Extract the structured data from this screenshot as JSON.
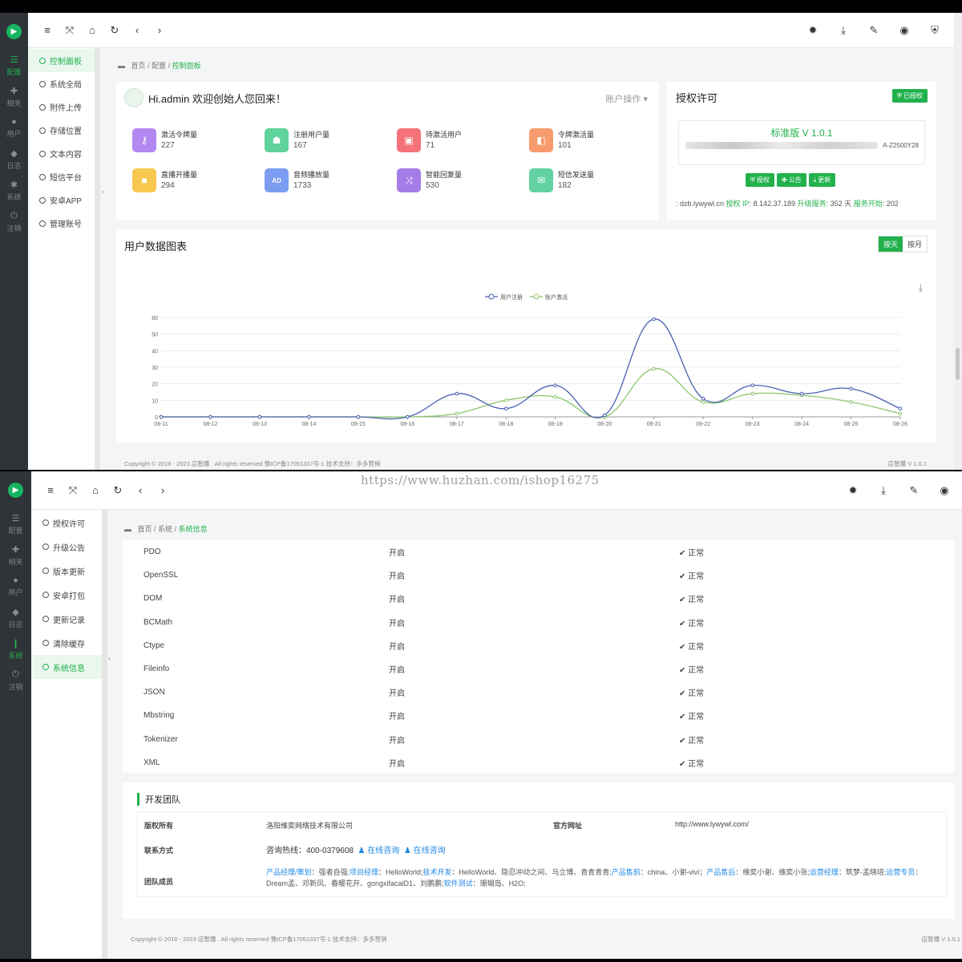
{
  "dashboard": {
    "rail": [
      "配置",
      "相关",
      "用户",
      "日志",
      "系统",
      "注销"
    ],
    "menu": [
      "控制面板",
      "系统全局",
      "附件上传",
      "存储位置",
      "文本内容",
      "短信平台",
      "安卓APP",
      "管理账号"
    ],
    "breadcrumb": {
      "home": "首页",
      "parent": "配置",
      "current": "控制面板"
    },
    "welcome": "Hi.admin 欢迎创始人您回来！",
    "account_ops": "账户操作",
    "stats": [
      {
        "label": "激活令牌量",
        "value": "227",
        "color": "#b388f0",
        "icon": "key-icon"
      },
      {
        "label": "注册用户量",
        "value": "167",
        "color": "#5fd39a",
        "icon": "users-icon"
      },
      {
        "label": "待激活用户",
        "value": "71",
        "color": "#f4737a",
        "icon": "lock-icon"
      },
      {
        "label": "令牌激活量",
        "value": "101",
        "color": "#f79b6e",
        "icon": "bag-icon"
      },
      {
        "label": "直播开播量",
        "value": "294",
        "color": "#f7c84d",
        "icon": "video-icon"
      },
      {
        "label": "音频播放量",
        "value": "1733",
        "color": "#7b9cf1",
        "icon": "ad-icon"
      },
      {
        "label": "智能回复量",
        "value": "530",
        "color": "#a57de8",
        "icon": "shuffle-icon"
      },
      {
        "label": "短信发送量",
        "value": "182",
        "color": "#62d2a2",
        "icon": "mail-icon"
      }
    ],
    "license": {
      "title": "授权许可",
      "badge": "已授权",
      "version": "标准版 V 1.0.1",
      "code": "A-Z2500Y28",
      "buttons": [
        "授权",
        "公告",
        "更新"
      ],
      "info_domain": ": dzb.lywywl.cn",
      "info_ip_label": "授权 IP",
      "info_ip": ": 8.142.37.189",
      "info_service_label": "升级服务",
      "info_service": ": 352 天",
      "info_start_label": "服务开始",
      "info_start": ": 202"
    },
    "chart_title": "用户数据图表",
    "toggle": [
      "按天",
      "按月"
    ],
    "footer": "Copyright © 2016 - 2023 店智播 . All rights reserved 豫ICP备17051337号-1 技术支持：多多营销",
    "footer_version": "店智播 V 1.0.1"
  },
  "chart_data": {
    "type": "line",
    "categories": [
      "08-11",
      "08-12",
      "08-13",
      "08-14",
      "08-15",
      "08-16",
      "08-17",
      "08-18",
      "08-19",
      "08-20",
      "08-21",
      "08-22",
      "08-23",
      "08-24",
      "08-25",
      "08-26"
    ],
    "series": [
      {
        "name": "用户注册",
        "color": "#4a5fb0",
        "values": [
          0,
          0,
          0,
          0,
          0,
          0,
          14,
          5,
          19,
          1,
          59,
          11,
          19,
          14,
          17,
          5
        ]
      },
      {
        "name": "账户激活",
        "color": "#8cc76e",
        "values": [
          0,
          0,
          0,
          0,
          0,
          0,
          2,
          10,
          12,
          0,
          29,
          9,
          14,
          13,
          9,
          2
        ]
      }
    ],
    "yticks": [
      0,
      10,
      20,
      30,
      40,
      50,
      60
    ],
    "ylim": [
      0,
      60
    ],
    "legend": "top-center",
    "grid": true
  },
  "system": {
    "rail": [
      "配置",
      "相关",
      "用户",
      "日志",
      "系统",
      "注销"
    ],
    "menu": [
      "授权许可",
      "升级公告",
      "版本更新",
      "安卓打包",
      "更新记录",
      "清除缓存",
      "系统信息"
    ],
    "breadcrumb": {
      "home": "首页",
      "parent": "系统",
      "current": "系统信息"
    },
    "extensions": [
      {
        "name": "PDO",
        "state": "开启",
        "status": "正常"
      },
      {
        "name": "OpenSSL",
        "state": "开启",
        "status": "正常"
      },
      {
        "name": "DOM",
        "state": "开启",
        "status": "正常"
      },
      {
        "name": "BCMath",
        "state": "开启",
        "status": "正常"
      },
      {
        "name": "Ctype",
        "state": "开启",
        "status": "正常"
      },
      {
        "name": "Fileinfo",
        "state": "开启",
        "status": "正常"
      },
      {
        "name": "JSON",
        "state": "开启",
        "status": "正常"
      },
      {
        "name": "Mbstring",
        "state": "开启",
        "status": "正常"
      },
      {
        "name": "Tokenizer",
        "state": "开启",
        "status": "正常"
      },
      {
        "name": "XML",
        "state": "开启",
        "status": "正常"
      }
    ],
    "team_title": "开发团队",
    "copyright_label": "版权所有",
    "copyright_value": "洛阳维奕网络技术有限公司",
    "site_label": "官方网址",
    "site_value": "http://www.lywywl.com/",
    "contact_label": "联系方式",
    "contact_hotline": "咨询热线：400-0379608",
    "contact_link1": "在线咨询",
    "contact_link2": "在线咨询",
    "members_label": "团队成员",
    "members_parts": [
      {
        "role": "产品经理/策划",
        "names": "：强者自强;"
      },
      {
        "role": "项目经理",
        "names": "：HelloWorld;"
      },
      {
        "role": "技术开发",
        "names": "：HelloWorld、隐忍冲动之间、马立博、青青青青;"
      },
      {
        "role": "产品售前",
        "names": "：china、小谢-vivi；"
      },
      {
        "role": "产品售后",
        "names": "：维奕小谢、维奕小张;"
      },
      {
        "role": "运营经理",
        "names": "：筑梦-孟晓培;"
      },
      {
        "role": "运营专员",
        "names": "：Dream孟、邓新凤、春暖花开、gongxifacaiD1、刘鹏鹏;"
      },
      {
        "role": "软件测试",
        "names": "：珊瑚岛、H2O;"
      }
    ],
    "footer": "Copyright © 2016 - 2023 店智播 . All rights reserved 豫ICP备17051337号-1 技术支持：多多营销",
    "footer_version": "店智播 V 1.0.1"
  },
  "watermark": "https://www.huzhan.com/ishop16275"
}
